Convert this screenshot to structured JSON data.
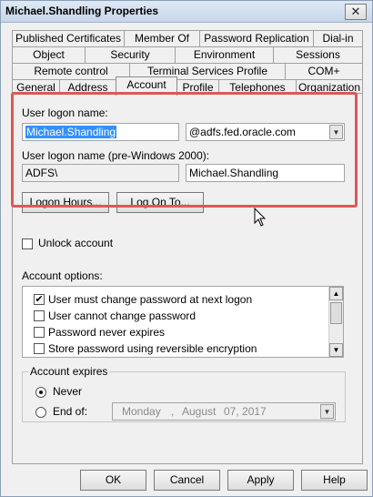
{
  "window": {
    "title": "Michael.Shandling Properties",
    "close_glyph": "✕"
  },
  "tabs": {
    "row1": [
      "Published Certificates",
      "Member Of",
      "Password Replication",
      "Dial-in"
    ],
    "row2": [
      "Object",
      "Security",
      "Environment",
      "Sessions"
    ],
    "row3": [
      "Remote control",
      "Terminal Services Profile",
      "COM+"
    ],
    "row4": [
      "General",
      "Address",
      "Account",
      "Profile",
      "Telephones",
      "Organization"
    ],
    "active": "Account"
  },
  "account": {
    "logon_name_label": "User logon name:",
    "logon_name_value": "Michael.Shandling",
    "domain_value": "@adfs.fed.oracle.com",
    "pre2000_label": "User logon name (pre-Windows 2000):",
    "pre2000_domain": "ADFS\\",
    "pre2000_user": "Michael.Shandling",
    "logon_hours_button": "Logon Hours...",
    "logon_to_button": "Log On To...",
    "unlock_label": "Unlock account",
    "options_label": "Account options:",
    "options": [
      {
        "label": "User must change password at next logon",
        "checked": true
      },
      {
        "label": "User cannot change password",
        "checked": false
      },
      {
        "label": "Password never expires",
        "checked": false
      },
      {
        "label": "Store password using reversible encryption",
        "checked": false
      }
    ],
    "expires": {
      "title": "Account expires",
      "never_label": "Never",
      "end_of_label": "End of:",
      "date_weekday": "Monday",
      "date_sep": ",",
      "date_month": "August",
      "date_day_year": "07, 2017",
      "selected": "never"
    }
  },
  "footer": {
    "ok": "OK",
    "cancel": "Cancel",
    "apply": "Apply",
    "help": "Help"
  },
  "colors": {
    "highlight_border": "#e05757",
    "selection": "#3390ff"
  },
  "icons": {
    "checkmark": "✔",
    "arrow_down": "▼",
    "arrow_up": "▲"
  }
}
